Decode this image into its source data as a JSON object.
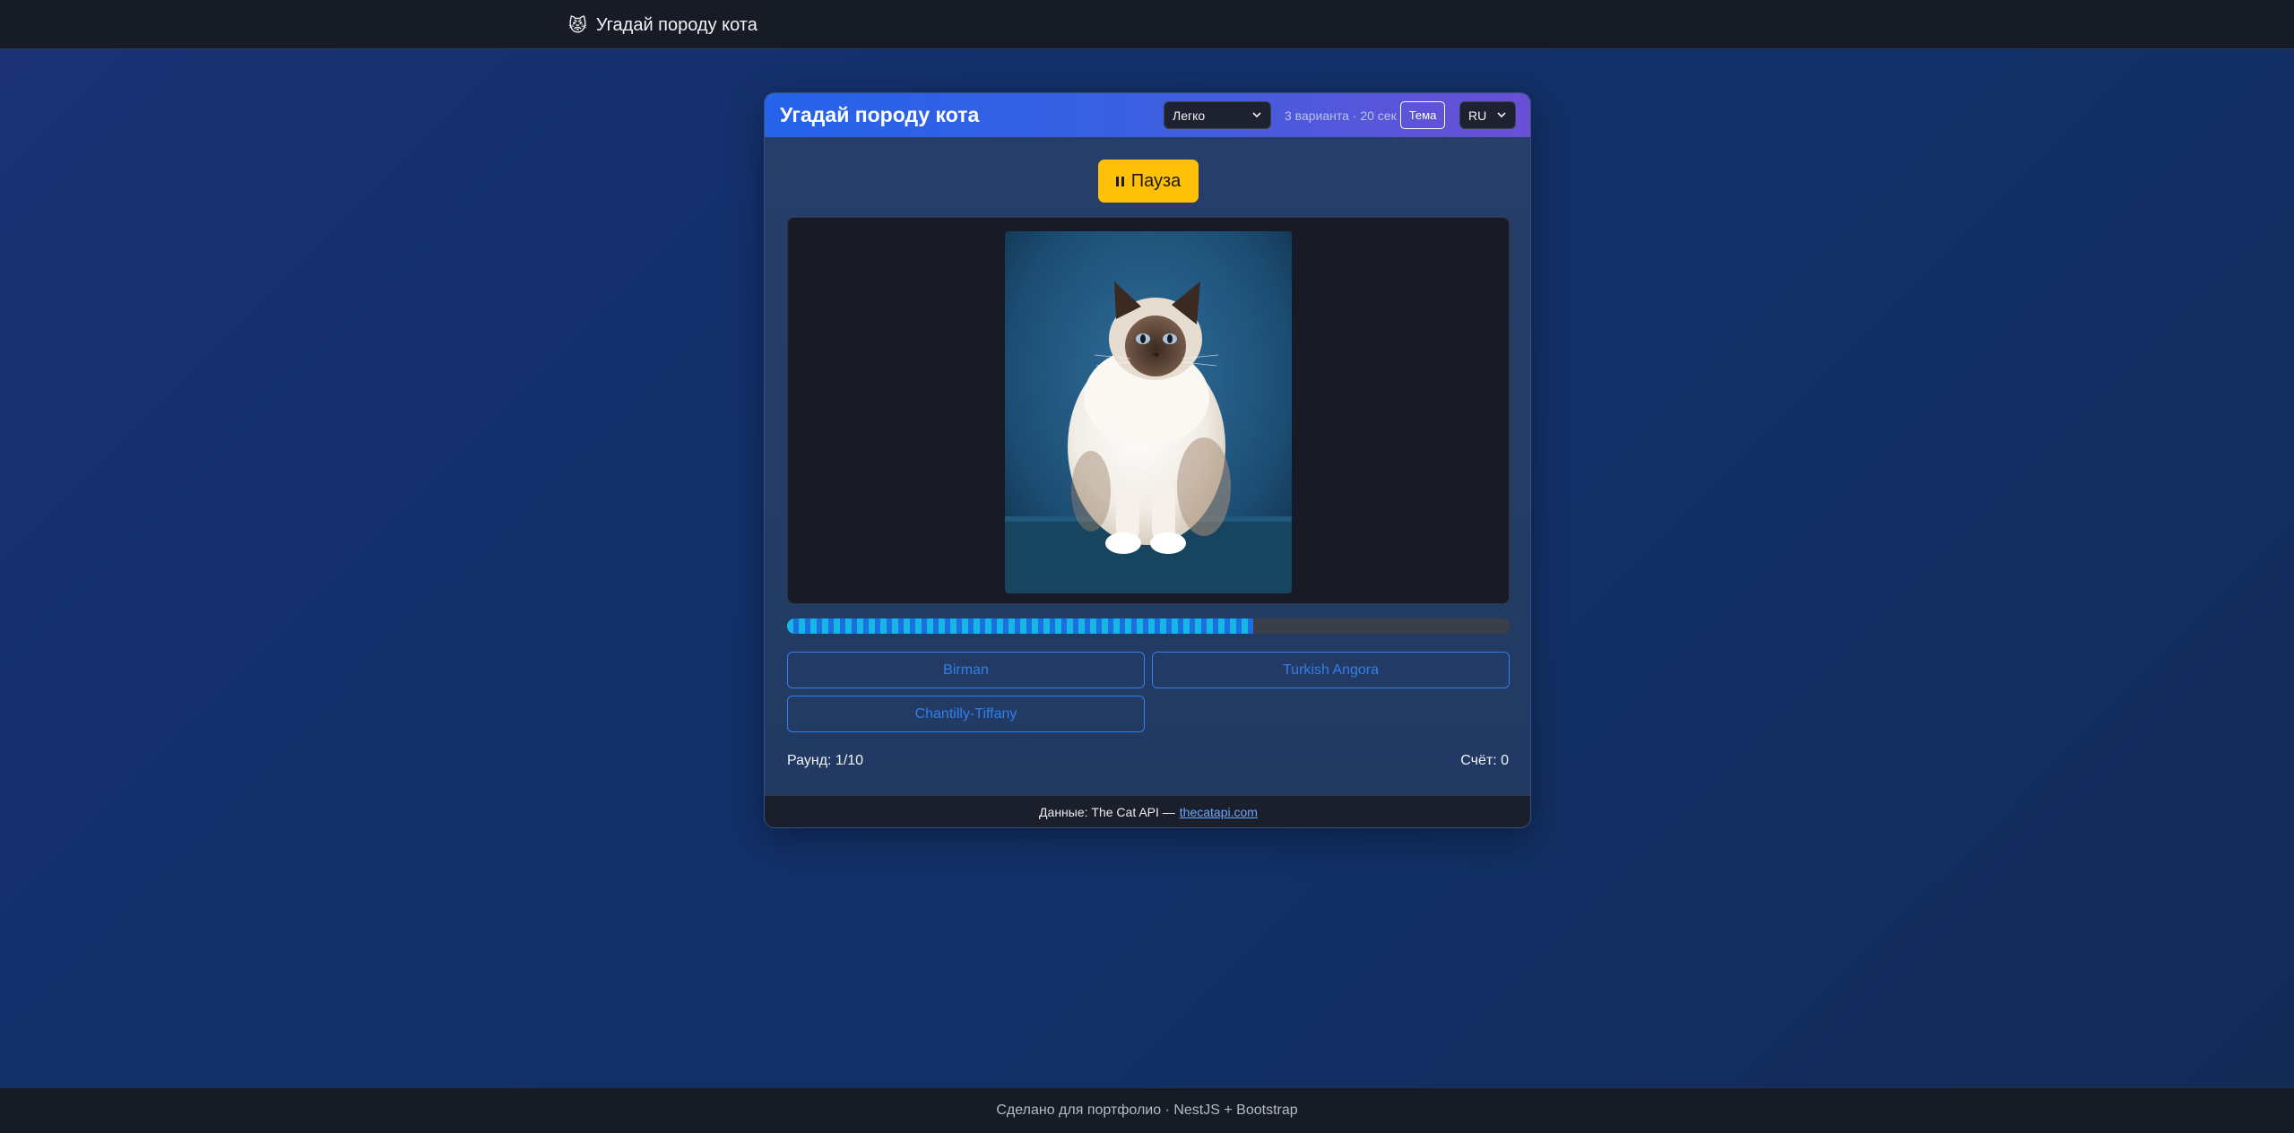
{
  "navbar": {
    "brand_icon": "😾",
    "brand_text": "Угадай породу кота"
  },
  "game": {
    "title": "Угадай породу кота",
    "difficulty": {
      "selected": "Легко"
    },
    "meta": "3 варианта · 20 сек",
    "theme_label": "Тема",
    "language": {
      "selected": "RU"
    },
    "pause_label": "Пауза",
    "image_alt": "cat photo",
    "timer_progress_percent": 64.5,
    "answers": [
      "Birman",
      "Turkish Angora",
      "Chantilly-Tiffany"
    ],
    "round": "Раунд: 1/10",
    "score": "Счёт: 0"
  },
  "card_footer": {
    "prefix": "Данные: The Cat API —",
    "link_text": "thecatapi.com"
  },
  "page_footer": {
    "text": "Сделано для портфолио · NestJS + Bootstrap"
  },
  "colors": {
    "accent": "#2563eb",
    "pause": "#ffc107",
    "answer": "#2f7ff0",
    "progress": "#16b7e6"
  },
  "icons": {
    "pause": "pause-icon",
    "chevron": "chevron-down-icon"
  }
}
